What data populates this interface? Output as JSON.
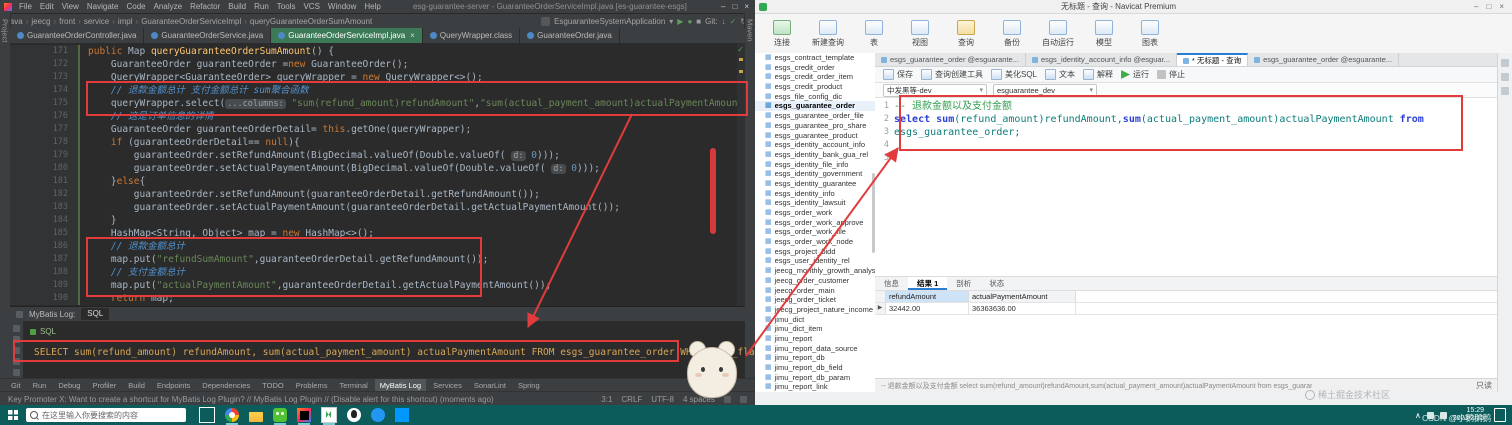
{
  "colors": {
    "annotation_red": "#e23b3b",
    "idea_bg": "#2b2b2b",
    "idea_active_tab_green": "#3c7a57",
    "navicat_keyword_blue": "#2a3fd8",
    "taskbar_teal": "#0d5c5c"
  },
  "idea": {
    "title": "esg-guarantee-server - GuaranteeOrderServiceImpl.java [es-guarantee-esgs]",
    "menus": [
      "File",
      "Edit",
      "View",
      "Navigate",
      "Code",
      "Analyze",
      "Refactor",
      "Build",
      "Run",
      "Tools",
      "VCS",
      "Window",
      "Help"
    ],
    "breadcrumb": [
      "java",
      "jeecg",
      "front",
      "service",
      "impl",
      "GuaranteeOrderServiceImpl",
      "queryGuaranteeOrderSumAmount"
    ],
    "toolbar": {
      "run_config": "EsguaranteeSystemApplication",
      "git_label": "Git:"
    },
    "left_tool_label": "Project",
    "right_tool_label": "Maven",
    "tabs": [
      {
        "label": "GuaranteeOrderController.java",
        "active": false
      },
      {
        "label": "GuaranteeOrderService.java",
        "active": false
      },
      {
        "label": "GuaranteeOrderServiceImpl.java",
        "active": true
      },
      {
        "label": "QueryWrapper.class",
        "active": false
      },
      {
        "label": "GuaranteeOrder.java",
        "active": false
      }
    ],
    "code": [
      {
        "n": 171,
        "segs": [
          [
            "kw",
            "public "
          ],
          [
            "pl",
            "Map "
          ],
          [
            "fn",
            "queryGuaranteeOrderSumAmount"
          ],
          [
            "pl",
            "() {"
          ]
        ]
      },
      {
        "n": 172,
        "segs": [
          [
            "pl",
            "    GuaranteeOrder guaranteeOrder ="
          ],
          [
            "kw",
            "new"
          ],
          [
            "pl",
            " GuaranteeOrder();"
          ]
        ]
      },
      {
        "n": 173,
        "segs": [
          [
            "pl",
            "    QueryWrapper<GuaranteeOrder> queryWrapper = "
          ],
          [
            "kw",
            "new"
          ],
          [
            "pl",
            " QueryWrapper<>();"
          ]
        ]
      },
      {
        "n": 174,
        "segs": [
          [
            "cm",
            "    // 退款金额总计 支付金额总计 sum聚合函数"
          ]
        ]
      },
      {
        "n": 175,
        "segs": [
          [
            "pl",
            "    queryWrapper.select("
          ],
          [
            "hint",
            "...columns:"
          ],
          [
            "pl",
            " "
          ],
          [
            "str",
            "\"sum(refund_amount)refundAmount\""
          ],
          [
            "pl",
            ","
          ],
          [
            "str",
            "\"sum(actual_payment_amount)actualPaymentAmount\""
          ],
          [
            "pl",
            ");"
          ]
        ]
      },
      {
        "n": 176,
        "segs": [
          [
            "cm",
            "    // 这是订单信息的详情"
          ]
        ]
      },
      {
        "n": 177,
        "segs": [
          [
            "pl",
            "    GuaranteeOrder guaranteeOrderDetail= "
          ],
          [
            "kw",
            "this"
          ],
          [
            "pl",
            ".getOne(queryWrapper);"
          ]
        ]
      },
      {
        "n": 178,
        "segs": [
          [
            "pl",
            "    "
          ],
          [
            "kw",
            "if"
          ],
          [
            "pl",
            " (guaranteeOrderDetail== "
          ],
          [
            "kw",
            "null"
          ],
          [
            "pl",
            "){"
          ]
        ]
      },
      {
        "n": 179,
        "segs": [
          [
            "pl",
            "        guaranteeOrder.setRefundAmount(BigDecimal.valueOf(Double.valueOf( "
          ],
          [
            "hint",
            "d:"
          ],
          [
            "pl",
            " "
          ],
          [
            "num",
            "0"
          ],
          [
            "pl",
            ")));"
          ]
        ]
      },
      {
        "n": 180,
        "segs": [
          [
            "pl",
            "        guaranteeOrder.setActualPaymentAmount(BigDecimal.valueOf(Double.valueOf( "
          ],
          [
            "hint",
            "d:"
          ],
          [
            "pl",
            " "
          ],
          [
            "num",
            "0"
          ],
          [
            "pl",
            ")));"
          ]
        ]
      },
      {
        "n": 181,
        "segs": [
          [
            "pl",
            "    }"
          ],
          [
            "kw",
            "else"
          ],
          [
            "pl",
            "{"
          ]
        ]
      },
      {
        "n": 182,
        "segs": [
          [
            "pl",
            "        guaranteeOrder.setRefundAmount(guaranteeOrderDetail.getRefundAmount());"
          ]
        ]
      },
      {
        "n": 183,
        "segs": [
          [
            "pl",
            "        guaranteeOrder.setActualPaymentAmount(guaranteeOrderDetail.getActualPaymentAmount());"
          ]
        ]
      },
      {
        "n": 184,
        "segs": [
          [
            "pl",
            "    }"
          ]
        ]
      },
      {
        "n": 185,
        "segs": [
          [
            "pl",
            "    HashMap<String, Object> map = "
          ],
          [
            "kw",
            "new"
          ],
          [
            "pl",
            " HashMap<>();"
          ]
        ]
      },
      {
        "n": 186,
        "segs": [
          [
            "cm",
            "    // 退款金额总计"
          ]
        ]
      },
      {
        "n": 187,
        "segs": [
          [
            "pl",
            "    map.put("
          ],
          [
            "str",
            "\"refundSumAmount\""
          ],
          [
            "pl",
            ",guaranteeOrderDetail.getRefundAmount());"
          ]
        ]
      },
      {
        "n": 188,
        "segs": [
          [
            "cm",
            "    // 支付金额总计"
          ]
        ]
      },
      {
        "n": 189,
        "segs": [
          [
            "pl",
            "    map.put("
          ],
          [
            "str",
            "\"actualPaymentAmount\""
          ],
          [
            "pl",
            ",guaranteeOrderDetail.getActualPaymentAmount());"
          ]
        ]
      },
      {
        "n": 190,
        "segs": [
          [
            "pl",
            "    "
          ],
          [
            "kw",
            "return"
          ],
          [
            "pl",
            " map;"
          ]
        ]
      }
    ],
    "log": {
      "panel_title": "MyBatis Log:",
      "tab": "SQL",
      "inner_label": "SQL",
      "sql": "SELECT sum(refund_amount) refundAmount, sum(actual_payment_amount) actualPaymentAmount FROM esgs_guarantee_order WHERE del_flag = 0"
    },
    "status_tabs": [
      "Git",
      "Run",
      "Debug",
      "Profiler",
      "Build",
      "Endpoints",
      "Dependencies",
      "TODO",
      "Problems",
      "Terminal",
      "MyBatis Log",
      "Services",
      "SonarLint",
      "Spring"
    ],
    "status_active_tab": "MyBatis Log",
    "status_message": "Key Promoter X: Want to create a shortcut for MyBatis Log Plugin? // MyBatis Log Plugin // (Disable alert for this shortcut) (moments ago)",
    "status_right_items": [
      "3:1",
      "CRLF",
      "UTF-8",
      "4 spaces"
    ]
  },
  "navicat": {
    "title": "无标题 - 查询 - Navicat Premium",
    "toolbar": [
      "连接",
      "新建查询",
      "表",
      "视图",
      "查询",
      "备份",
      "自动运行",
      "模型",
      "图表"
    ],
    "tree": [
      "esgs_contract_template",
      "esgs_credit_order",
      "esgs_credit_order_item",
      "esgs_credit_product",
      "esgs_file_config_dic",
      "esgs_guarantee_order",
      "esgs_guarantee_order_file",
      "esgs_guarantee_pro_share",
      "esgs_guarantee_product",
      "esgs_identity_account_info",
      "esgs_identity_bank_gua_rel",
      "esgs_identity_file_info",
      "esgs_identity_government",
      "esgs_identity_guarantee",
      "esgs_identity_info",
      "esgs_identity_lawsuit",
      "esgs_order_work",
      "esgs_order_work_approve",
      "esgs_order_work_file",
      "esgs_order_work_node",
      "esgs_project_bidd",
      "esgs_user_identity_rel",
      "jeecg_monthly_growth_analysis",
      "jeecg_order_customer",
      "jeecg_order_main",
      "jeecg_order_ticket",
      "jeecg_project_nature_income",
      "jimu_dict",
      "jimu_dict_item",
      "jimu_report",
      "jimu_report_data_source",
      "jimu_report_db",
      "jimu_report_db_field",
      "jimu_report_db_param",
      "jimu_report_link"
    ],
    "tree_selected": "esgs_guarantee_order",
    "doc_tabs": [
      {
        "label": "esgs_guarantee_order @esguarante...",
        "active": false
      },
      {
        "label": "esgs_identity_account_info @esguar...",
        "active": false
      },
      {
        "label": "* 无标题 - 查询",
        "active": true
      },
      {
        "label": "esgs_guarantee_order @esguarante...",
        "active": false
      }
    ],
    "query_toolbar": [
      "保存",
      "查询创建工具",
      "美化SQL",
      "文本",
      "解释",
      "运行",
      "停止"
    ],
    "connections": [
      "中发黑等-dev",
      "esguarantee_dev"
    ],
    "sql_lines": [
      {
        "n": 1,
        "segs": [
          [
            "cm",
            "-- 退款金额以及支付金额"
          ]
        ]
      },
      {
        "n": 2,
        "segs": [
          [
            "kw",
            "select "
          ],
          [
            "kw",
            "sum"
          ],
          [
            "id",
            "(refund_amount)refundAmount,"
          ],
          [
            "kw",
            "sum"
          ],
          [
            "id",
            "(actual_payment_amount)actualPaymentAmount "
          ],
          [
            "kw",
            "from"
          ]
        ]
      },
      {
        "n": 3,
        "segs": [
          [
            "id",
            "esgs_guarantee_order;"
          ]
        ]
      },
      {
        "n": 4,
        "segs": []
      },
      {
        "n": 5,
        "segs": []
      }
    ],
    "result_tabs": [
      "信息",
      "结果 1",
      "剖析",
      "状态"
    ],
    "result_active_tab": "结果 1",
    "grid": {
      "columns": [
        "refundAmount",
        "actualPaymentAmount"
      ],
      "rows": [
        [
          "32442.00",
          "36363636.00"
        ]
      ]
    },
    "status_left": "-- 退款金额以及支付金额 select sum(refund_amount)refundAmount,sum(actual_payment_amount)actualPaymentAmount from esgs_guarar",
    "status_right": "只读"
  },
  "taskbar": {
    "search_placeholder": "在这里输入你要搜索的内容",
    "icons": [
      "task-view",
      "browser",
      "folder",
      "wechat",
      "idea",
      "navicat",
      "qq",
      "dingtalk",
      "vscode"
    ],
    "open_icons": [
      "browser",
      "wechat",
      "idea",
      "navicat"
    ],
    "time": "15:29",
    "date": "2023/2/15"
  },
  "watermarks": {
    "juejin": "稀土掘金技术社区",
    "csdn": "CSDN @小鹅鹅鹅"
  }
}
